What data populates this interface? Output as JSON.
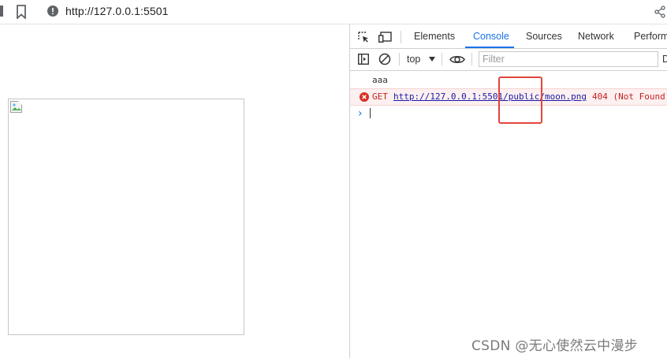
{
  "browser": {
    "url": "http://127.0.0.1:5501"
  },
  "devtools": {
    "tabs": [
      {
        "label": "Elements",
        "active": false
      },
      {
        "label": "Console",
        "active": true
      },
      {
        "label": "Sources",
        "active": false
      },
      {
        "label": "Network",
        "active": false
      },
      {
        "label": "Perform",
        "active": false
      }
    ],
    "toolbar": {
      "context": "top",
      "filter_placeholder": "Filter",
      "levels_label": "D"
    },
    "console": {
      "log_message": "aaa",
      "error": {
        "method": "GET",
        "url": "http://127.0.0.1:5501/public/moon.png",
        "status": "404 (Not Found)"
      }
    }
  },
  "colors": {
    "accent": "#1a73e8",
    "error": "#c5221f",
    "highlight": "#e2453c"
  },
  "watermark": "CSDN @无心使然云中漫步"
}
